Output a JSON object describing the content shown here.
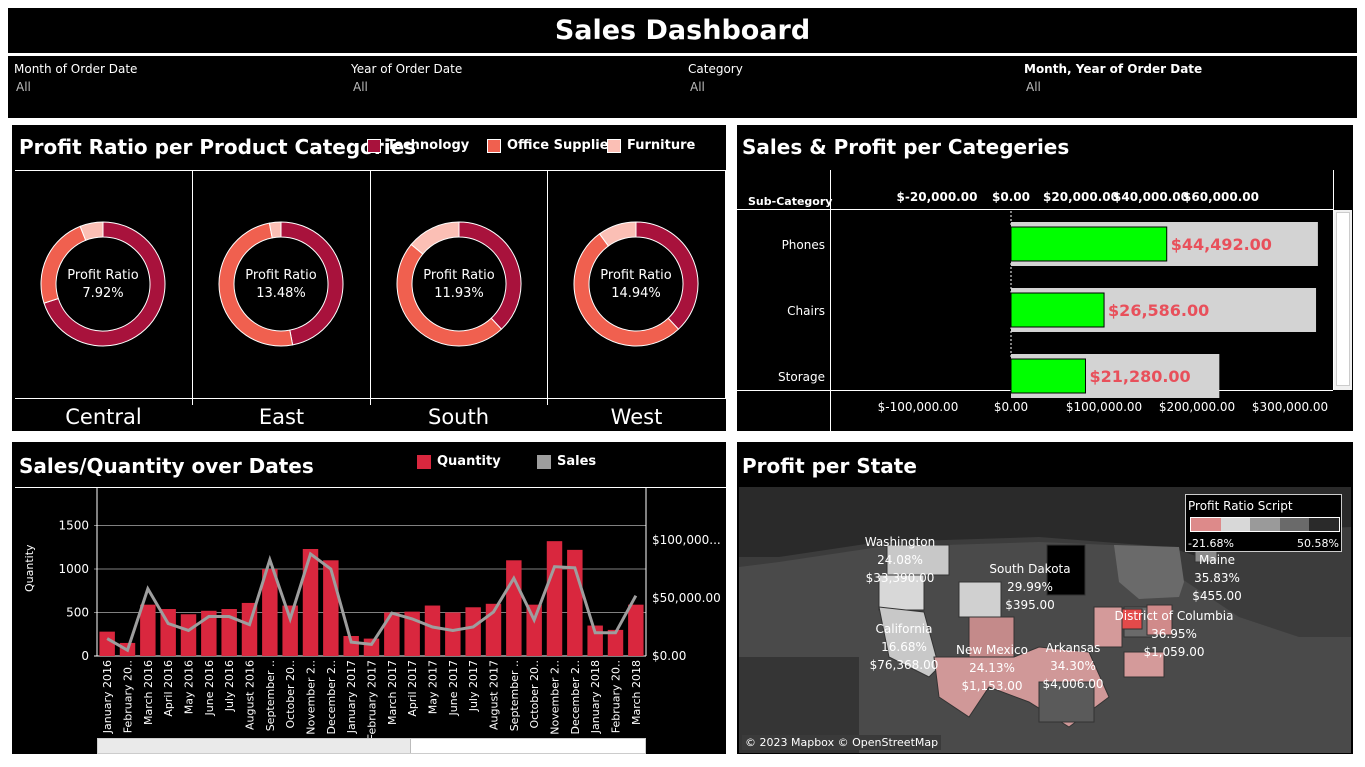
{
  "title": "Sales Dashboard",
  "filters": [
    {
      "label": "Month of Order Date",
      "value": "All"
    },
    {
      "label": "Year of Order Date",
      "value": "All"
    },
    {
      "label": "Category",
      "value": "All"
    },
    {
      "label": "Month, Year of Order Date",
      "value": "All"
    }
  ],
  "profit_ratio": {
    "title": "Profit Ratio per Product Categories",
    "legend": [
      {
        "name": "Technology",
        "color": "#a8123c"
      },
      {
        "name": "Office Supplies",
        "color": "#f0604f"
      },
      {
        "name": "Furniture",
        "color": "#fbbfb5"
      }
    ],
    "center_label": "Profit Ratio",
    "regions": [
      {
        "name": "Central",
        "ratio": "7.92%",
        "shares": [
          0.7,
          0.24,
          0.06
        ]
      },
      {
        "name": "East",
        "ratio": "13.48%",
        "shares": [
          0.47,
          0.5,
          0.03
        ]
      },
      {
        "name": "South",
        "ratio": "11.93%",
        "shares": [
          0.38,
          0.48,
          0.14
        ]
      },
      {
        "name": "West",
        "ratio": "14.94%",
        "shares": [
          0.38,
          0.52,
          0.1
        ]
      }
    ]
  },
  "sales_profit": {
    "title": "Sales & Profit per Categeries",
    "column_header": "Sub-Category",
    "top_axis_ticks": [
      "$-20,000.00",
      "$0.00",
      "$20,000.00",
      "$40,000.00",
      "$60,000.00"
    ],
    "bottom_axis_ticks": [
      "$-100,000.00",
      "$0.00",
      "$100,000.00",
      "$200,000.00",
      "$300,000.00"
    ],
    "rows": [
      {
        "name": "Phones",
        "profit": 44492,
        "sales": 330000,
        "profit_label": "$44,492.00"
      },
      {
        "name": "Chairs",
        "profit": 26586,
        "sales": 328000,
        "profit_label": "$26,586.00"
      },
      {
        "name": "Storage",
        "profit": 21280,
        "sales": 224000,
        "profit_label": "$21,280.00"
      }
    ],
    "profit_color": "#00ff00",
    "sales_color": "#d3d3d3",
    "label_color": "#e8505b"
  },
  "sales_quantity": {
    "title": "Sales/Quantity over Dates",
    "legend": [
      {
        "name": "Quantity",
        "color": "#d9273e"
      },
      {
        "name": "Sales",
        "color": "#9e9e9e"
      }
    ],
    "y_label": "Quantity",
    "left_ticks": [
      "1500",
      "1000",
      "500",
      "0"
    ],
    "right_ticks": [
      "$100,000...",
      "$50,000.00",
      "$0.00"
    ],
    "categories": [
      "January 2016",
      "February 20..",
      "March 2016",
      "April 2016",
      "May 2016",
      "June 2016",
      "July 2016",
      "August 2016",
      "September ..",
      "October 20..",
      "November 2..",
      "December 2..",
      "January 2017",
      "February 2017",
      "March 2017",
      "April 2017",
      "May 2017",
      "June 2017",
      "July 2017",
      "August 2017",
      "September ..",
      "October 20..",
      "November 2..",
      "December 2..",
      "January 2018",
      "February 20..",
      "March 2018"
    ],
    "quantity": [
      280,
      150,
      590,
      540,
      480,
      520,
      540,
      610,
      1000,
      580,
      1230,
      1100,
      230,
      200,
      500,
      510,
      580,
      500,
      560,
      600,
      1100,
      590,
      1320,
      1220,
      350,
      300,
      590
    ],
    "sales": [
      15000,
      5000,
      58000,
      28000,
      22000,
      34000,
      34000,
      27000,
      83000,
      32000,
      88000,
      75000,
      12000,
      10000,
      37000,
      32000,
      25000,
      22000,
      25000,
      38000,
      67000,
      31000,
      77000,
      76000,
      20000,
      20000,
      52000
    ]
  },
  "profit_state": {
    "title": "Profit per State",
    "legend_title": "Profit Ratio Script",
    "legend_min": "-21.68%",
    "legend_max": "50.58%",
    "attribution": "© 2023 Mapbox © OpenStreetMap",
    "labels": [
      {
        "state": "Washington",
        "ratio": "24.08%",
        "profit": "$33,390.00"
      },
      {
        "state": "South Dakota",
        "ratio": "29.99%",
        "profit": "$395.00"
      },
      {
        "state": "Maine",
        "ratio": "35.83%",
        "profit": "$455.00"
      },
      {
        "state": "California",
        "ratio": "16.68%",
        "profit": "$76,368.00"
      },
      {
        "state": "District of Columbia",
        "ratio": "36.95%",
        "profit": "$1,059.00"
      },
      {
        "state": "New Mexico",
        "ratio": "24.13%",
        "profit": "$1,153.00"
      },
      {
        "state": "Arkansas",
        "ratio": "34.30%",
        "profit": "$4,006.00"
      }
    ]
  }
}
